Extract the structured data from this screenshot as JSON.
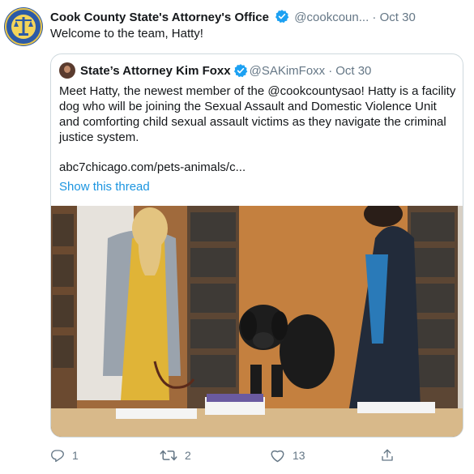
{
  "tweet": {
    "author_name": "Cook County State's Attorney's Office",
    "author_handle": "@cookcoun...",
    "separator": "·",
    "time": "Oct 30",
    "text": "Welcome to the team, Hatty!",
    "avatar_icon": "cook-county-seal",
    "verified_icon": "verified-badge-icon"
  },
  "quoted": {
    "author_name": "State’s Attorney Kim Foxx",
    "author_handle": "@SAKimFoxx",
    "separator": "·",
    "time": "Oct 30",
    "text": "Meet Hatty, the newest member of the @cookcountysao! Hatty is a facility dog who will be joining the Sexual Assault and Domestic Violence Unit and comforting child sexual assault victims as they navigate the criminal justice system.",
    "link": "abc7chicago.com/pets-animals/c...",
    "show_thread": "Show this thread",
    "image_description_icon": "photo-dog-at-desk"
  },
  "actions": {
    "reply_count": "1",
    "retweet_count": "2",
    "like_count": "13",
    "reply_icon": "reply-icon",
    "retweet_icon": "retweet-icon",
    "like_icon": "heart-icon",
    "share_icon": "share-icon"
  },
  "colors": {
    "link_blue": "#1b95e0",
    "secondary_text": "#657786",
    "verified_blue": "#1da1f2",
    "border": "#cfd9de"
  }
}
